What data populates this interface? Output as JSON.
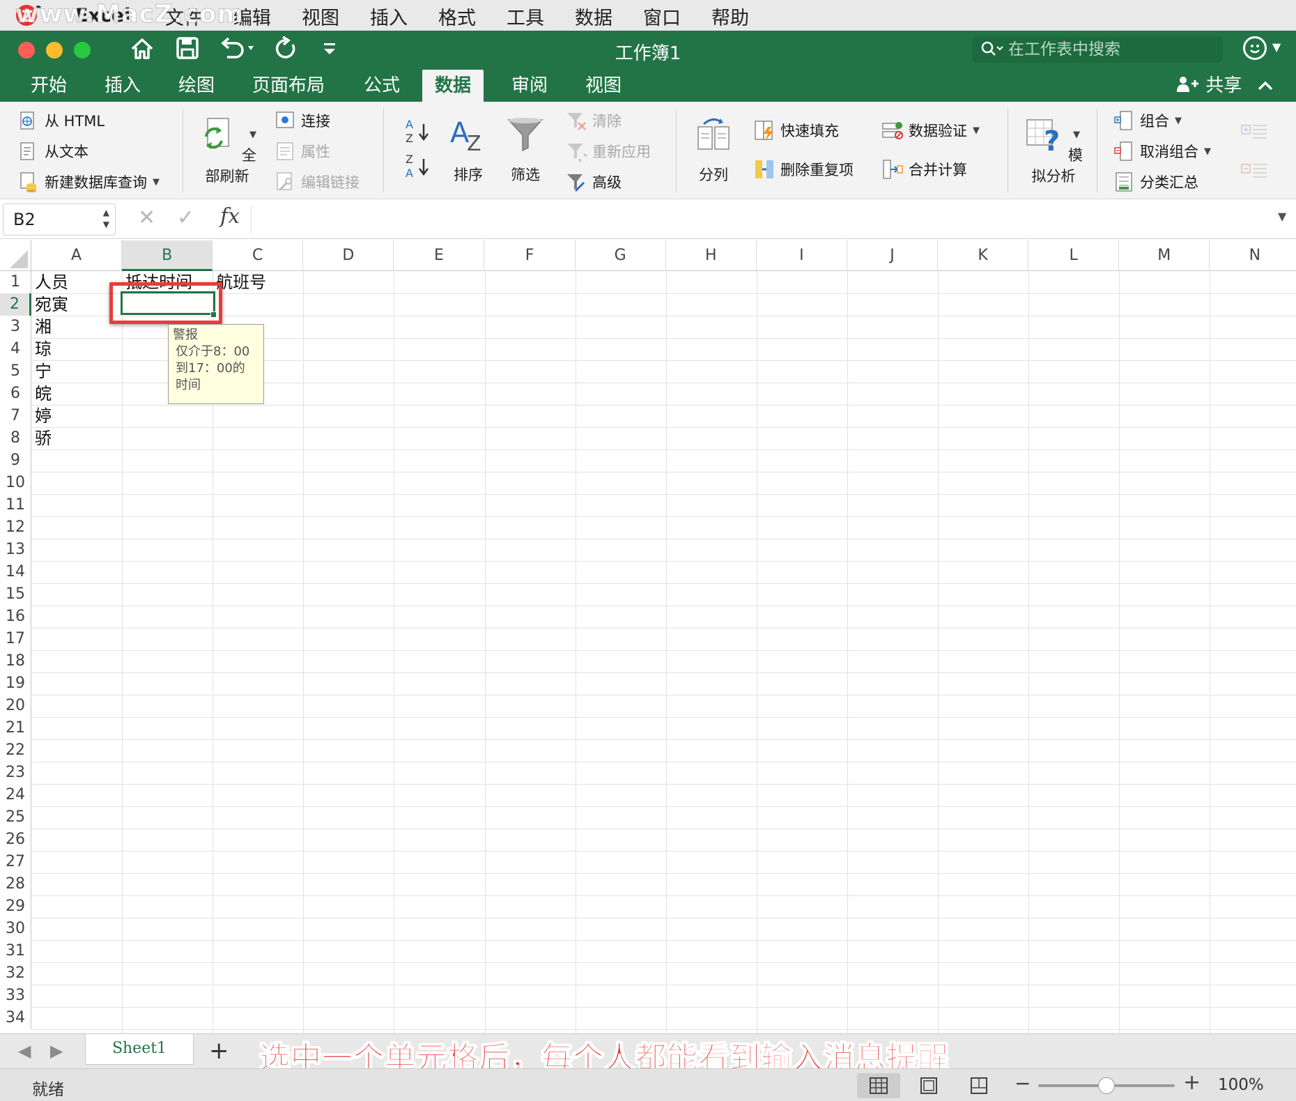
{
  "menubar": {
    "watermark": "www.MacZ.com",
    "app": "Excel",
    "items": [
      "文件",
      "编辑",
      "视图",
      "插入",
      "格式",
      "工具",
      "数据",
      "窗口",
      "帮助"
    ]
  },
  "titlebar": {
    "doc_title": "工作簿1",
    "search_placeholder": "在工作表中搜索"
  },
  "tabs": {
    "items": [
      "开始",
      "插入",
      "绘图",
      "页面布局",
      "公式",
      "数据",
      "审阅",
      "视图"
    ],
    "active": "数据",
    "share": "共享"
  },
  "ribbon": {
    "from_html": "从 HTML",
    "from_text": "从文本",
    "new_query": "新建数据库查询",
    "refresh_all": "全部刷新",
    "connections": "连接",
    "properties": "属性",
    "edit_links": "编辑链接",
    "sort": "排序",
    "filter": "筛选",
    "clear": "清除",
    "reapply": "重新应用",
    "advanced": "高级",
    "text_to_columns": "分列",
    "flash_fill": "快速填充",
    "remove_duplicates": "删除重复项",
    "data_validation": "数据验证",
    "consolidate": "合并计算",
    "what_if": "模拟分析",
    "group": "组合",
    "ungroup": "取消组合",
    "subtotal": "分类汇总"
  },
  "formula_bar": {
    "name_box": "B2",
    "fx": "fx",
    "formula": ""
  },
  "grid": {
    "columns": [
      "A",
      "B",
      "C",
      "D",
      "E",
      "F",
      "G",
      "H",
      "I",
      "J",
      "K",
      "L",
      "M",
      "N"
    ],
    "row_count": 34,
    "selected_cell": "B2",
    "cells": {
      "A1": "人员",
      "B1": "抵达时间",
      "C1": "航班号",
      "A2": "宛寅",
      "A3": "湘",
      "A4": "琼",
      "A5": "宁",
      "A6": "皖",
      "A7": "婷",
      "A8": "骄"
    }
  },
  "tooltip": {
    "title": "警报",
    "line1": "仅介于8：00",
    "line2": "到17：00的",
    "line3": "时间"
  },
  "sheet_bar": {
    "sheet_name": "Sheet1",
    "caption": "选中一个单元格后，每个人都能看到输入消息提醒"
  },
  "status_bar": {
    "status": "就绪",
    "zoom": "100%",
    "zoom_level_percent": 100
  },
  "colors": {
    "excel_green": "#227447",
    "highlight_red": "#ec3b37",
    "tooltip_bg": "#ffffe0"
  }
}
